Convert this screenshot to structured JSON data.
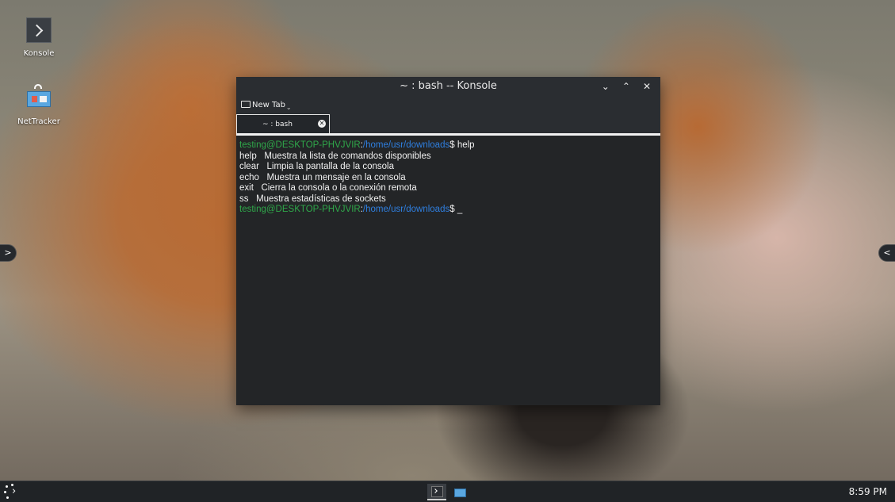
{
  "desktop": {
    "icons": [
      {
        "label": "Konsole"
      },
      {
        "label": "NetTracker"
      }
    ]
  },
  "window": {
    "title": "~ : bash -- Konsole",
    "toolbar": {
      "new_tab_label": "New Tab"
    },
    "tab": {
      "label": "~ : bash"
    }
  },
  "terminal": {
    "prompt_user": "testing@DESKTOP-PHVJVIR",
    "prompt_sep": ":",
    "prompt_path": "/home/usr/downloads",
    "prompt_symbol": "$",
    "command": " help",
    "lines": [
      "help   Muestra la lista de comandos disponibles",
      "clear   Limpia la pantalla de la consola",
      "echo   Muestra un mensaje en la consola",
      "exit   Cierra la consola o la conexión remota",
      "ss   Muestra estadísticas de sockets"
    ],
    "cursor": " _"
  },
  "taskbar": {
    "clock": "8:59 PM"
  }
}
